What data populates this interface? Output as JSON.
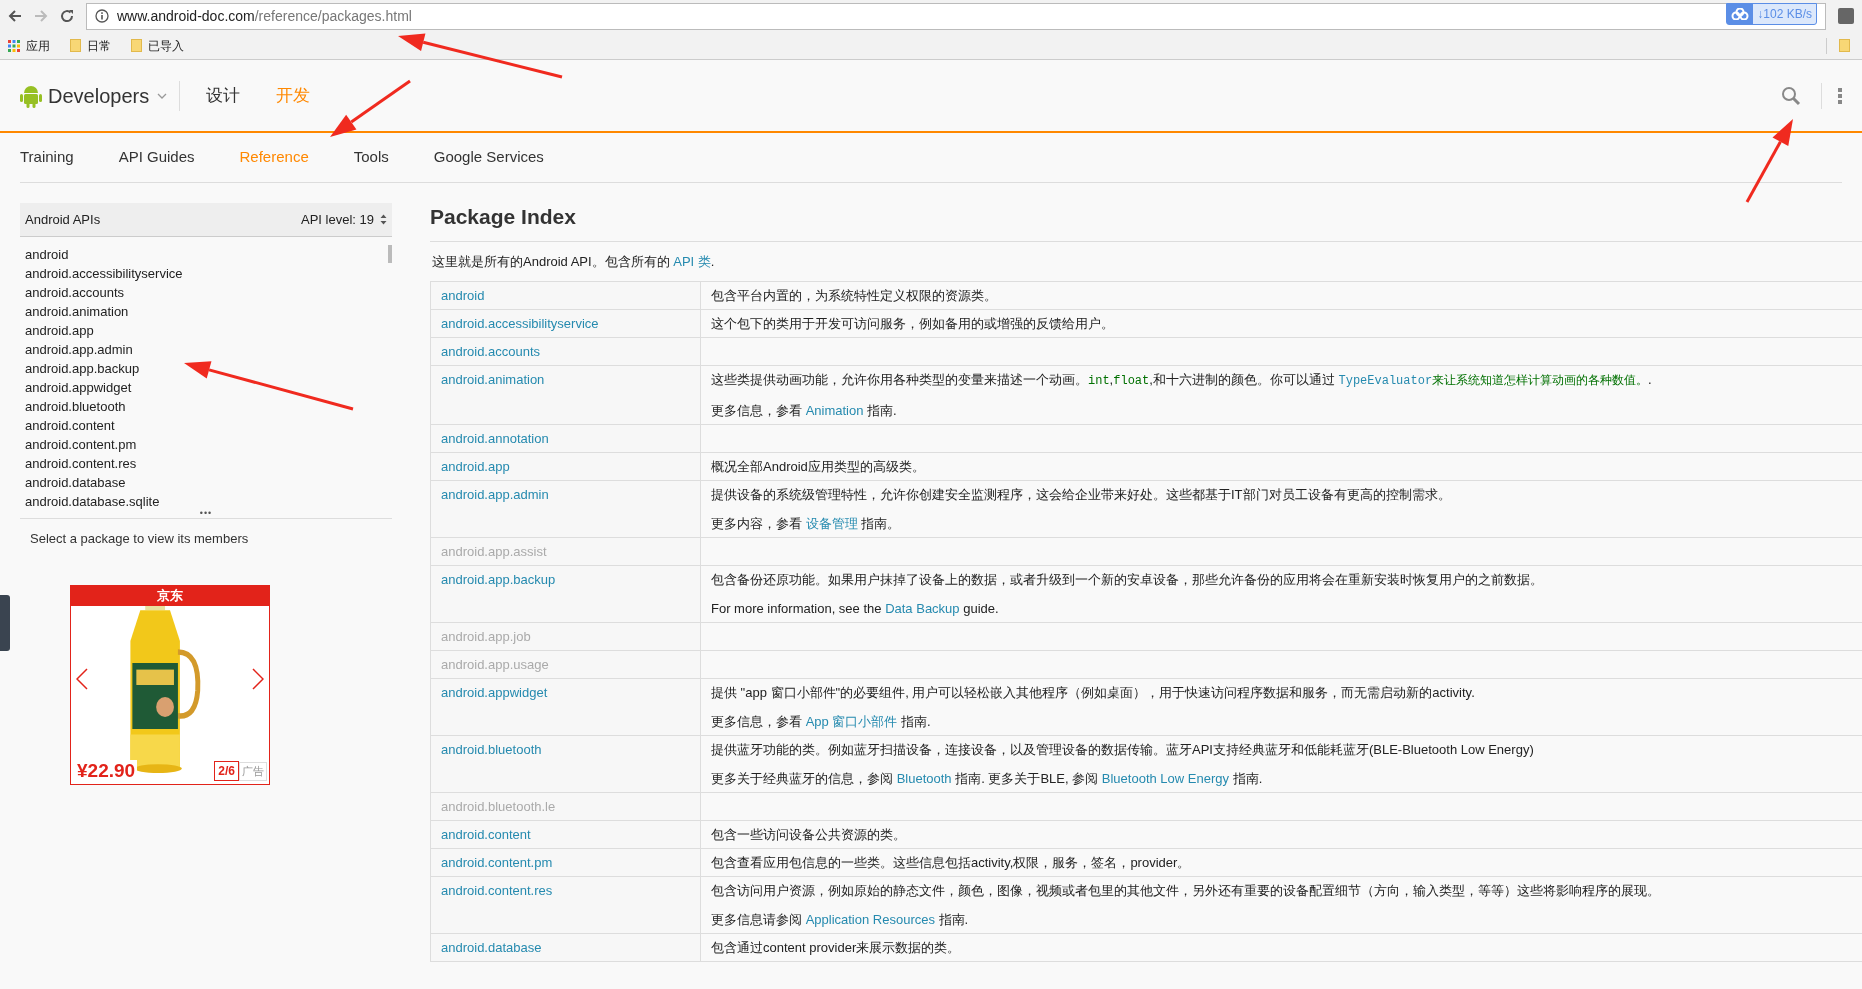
{
  "browser": {
    "url_host": "www.android-doc.com",
    "url_path": "/reference/packages.html",
    "download_speed": "↓102 KB/s",
    "bookmarks": [
      {
        "label": "应用",
        "kind": "apps"
      },
      {
        "label": "日常",
        "kind": "folder"
      },
      {
        "label": "已导入",
        "kind": "folder"
      }
    ]
  },
  "header": {
    "brand": "Developers",
    "sections": [
      {
        "label": "设计",
        "selected": false
      },
      {
        "label": "开发",
        "selected": true
      }
    ]
  },
  "nav_tabs": [
    {
      "label": "Training",
      "selected": false
    },
    {
      "label": "API Guides",
      "selected": false
    },
    {
      "label": "Reference",
      "selected": true
    },
    {
      "label": "Tools",
      "selected": false
    },
    {
      "label": "Google Services",
      "selected": false
    }
  ],
  "sidebar": {
    "title": "Android APIs",
    "api_level": "API level: 19",
    "more": "•••",
    "hint": "Select a package to view its members",
    "packages": [
      "android",
      "android.accessibilityservice",
      "android.accounts",
      "android.animation",
      "android.app",
      "android.app.admin",
      "android.app.backup",
      "android.appwidget",
      "android.bluetooth",
      "android.content",
      "android.content.pm",
      "android.content.res",
      "android.database",
      "android.database.sqlite"
    ],
    "ad": {
      "brand": "京东",
      "price": "¥22.90",
      "page": "2/6",
      "tag": "广告"
    }
  },
  "main": {
    "title": "Package Index",
    "intro": [
      {
        "kind": "text",
        "text": "这里就是所有的Android API。包含所有的 "
      },
      {
        "kind": "link",
        "text": "API 类"
      },
      {
        "kind": "text",
        "text": "."
      }
    ],
    "rows": [
      {
        "name": "android",
        "disabled": false,
        "paragraphs": [
          [
            {
              "kind": "text",
              "text": "包含平台内置的，为系统特性定义权限的资源类。"
            }
          ]
        ]
      },
      {
        "name": "android.accessibilityservice",
        "disabled": false,
        "paragraphs": [
          [
            {
              "kind": "text",
              "text": "这个包下的类用于开发可访问服务，例如备用的或增强的反馈给用户。"
            }
          ]
        ]
      },
      {
        "name": "android.accounts",
        "disabled": false,
        "paragraphs": []
      },
      {
        "name": "android.animation",
        "disabled": false,
        "paragraphs": [
          [
            {
              "kind": "text",
              "text": "这些类提供动画功能，允许你用各种类型的变量来描述一个动画。"
            },
            {
              "kind": "code",
              "text": "int"
            },
            {
              "kind": "text",
              "text": ","
            },
            {
              "kind": "code",
              "text": "float"
            },
            {
              "kind": "text",
              "text": ",和十六进制的颜色。你可以通过 "
            },
            {
              "kind": "codelink",
              "text": "TypeEvaluator"
            },
            {
              "kind": "code",
              "text": "来让系统知道怎样计算动画的各种数值。"
            },
            {
              "kind": "text",
              "text": "."
            }
          ],
          [
            {
              "kind": "text",
              "text": "更多信息，参看 "
            },
            {
              "kind": "link",
              "text": "Animation"
            },
            {
              "kind": "text",
              "text": " 指南."
            }
          ]
        ]
      },
      {
        "name": "android.annotation",
        "disabled": false,
        "paragraphs": []
      },
      {
        "name": "android.app",
        "disabled": false,
        "paragraphs": [
          [
            {
              "kind": "text",
              "text": "概况全部Android应用类型的高级类。"
            }
          ]
        ]
      },
      {
        "name": "android.app.admin",
        "disabled": false,
        "paragraphs": [
          [
            {
              "kind": "text",
              "text": "提供设备的系统级管理特性，允许你创建安全监测程序，这会给企业带来好处。这些都基于IT部门对员工设备有更高的控制需求。"
            }
          ],
          [
            {
              "kind": "text",
              "text": "更多内容，参看 "
            },
            {
              "kind": "link",
              "text": "设备管理"
            },
            {
              "kind": "text",
              "text": " 指南。"
            }
          ]
        ]
      },
      {
        "name": "android.app.assist",
        "disabled": true,
        "paragraphs": []
      },
      {
        "name": "android.app.backup",
        "disabled": false,
        "paragraphs": [
          [
            {
              "kind": "text",
              "text": "包含备份还原功能。如果用户抹掉了设备上的数据，或者升级到一个新的安卓设备，那些允许备份的应用将会在重新安装时恢复用户的之前数据。"
            }
          ],
          [
            {
              "kind": "text",
              "text": "For more information, see the "
            },
            {
              "kind": "link",
              "text": "Data Backup"
            },
            {
              "kind": "text",
              "text": " guide."
            }
          ]
        ]
      },
      {
        "name": "android.app.job",
        "disabled": true,
        "paragraphs": []
      },
      {
        "name": "android.app.usage",
        "disabled": true,
        "paragraphs": []
      },
      {
        "name": "android.appwidget",
        "disabled": false,
        "paragraphs": [
          [
            {
              "kind": "text",
              "text": "提供 \"app 窗口小部件\"的必要组件, 用户可以轻松嵌入其他程序（例如桌面），用于快速访问程序数据和服务，而无需启动新的activity."
            }
          ],
          [
            {
              "kind": "text",
              "text": "更多信息，参看 "
            },
            {
              "kind": "link",
              "text": "App 窗口小部件"
            },
            {
              "kind": "text",
              "text": " 指南."
            }
          ]
        ]
      },
      {
        "name": "android.bluetooth",
        "disabled": false,
        "paragraphs": [
          [
            {
              "kind": "text",
              "text": "提供蓝牙功能的类。例如蓝牙扫描设备，连接设备，以及管理设备的数据传输。蓝牙API支持经典蓝牙和低能耗蓝牙(BLE-Bluetooth Low Energy)"
            }
          ],
          [
            {
              "kind": "text",
              "text": "更多关于经典蓝牙的信息，参阅 "
            },
            {
              "kind": "link",
              "text": "Bluetooth"
            },
            {
              "kind": "text",
              "text": " 指南. 更多关于BLE, 参阅 "
            },
            {
              "kind": "link",
              "text": "Bluetooth Low Energy"
            },
            {
              "kind": "text",
              "text": " 指南."
            }
          ]
        ]
      },
      {
        "name": "android.bluetooth.le",
        "disabled": true,
        "paragraphs": []
      },
      {
        "name": "android.content",
        "disabled": false,
        "paragraphs": [
          [
            {
              "kind": "text",
              "text": "包含一些访问设备公共资源的类。"
            }
          ]
        ]
      },
      {
        "name": "android.content.pm",
        "disabled": false,
        "paragraphs": [
          [
            {
              "kind": "text",
              "text": "包含查看应用包信息的一些类。这些信息包括activity,权限，服务，签名，provider。"
            }
          ]
        ]
      },
      {
        "name": "android.content.res",
        "disabled": false,
        "paragraphs": [
          [
            {
              "kind": "text",
              "text": "包含访问用户资源，例如原始的静态文件，颜色，图像，视频或者包里的其他文件，另外还有重要的设备配置细节（方向，输入类型，等等）这些将影响程序的展现。"
            }
          ],
          [
            {
              "kind": "text",
              "text": "更多信息请参阅 "
            },
            {
              "kind": "link",
              "text": "Application Resources"
            },
            {
              "kind": "text",
              "text": " 指南."
            }
          ]
        ]
      },
      {
        "name": "android.database",
        "disabled": false,
        "paragraphs": [
          [
            {
              "kind": "text",
              "text": "包含通过content provider来展示数据的类。"
            }
          ]
        ]
      }
    ]
  }
}
